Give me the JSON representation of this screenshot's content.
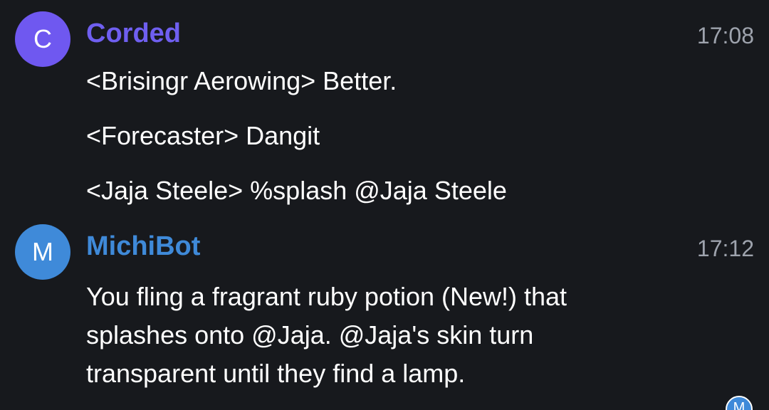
{
  "colors": {
    "background": "#17191d",
    "corded_avatar": "#6f58f0",
    "corded_name": "#6f5ff0",
    "michibot_avatar": "#3f8ad9",
    "michibot_name": "#3f8ad9",
    "timestamp": "#9ea3ad"
  },
  "messages": [
    {
      "avatar_letter": "C",
      "author": "Corded",
      "time": "17:08",
      "lines": [
        "<Brisingr Aerowing> Better.",
        "<Forecaster> Dangit",
        "<Jaja Steele> %splash @Jaja Steele"
      ]
    },
    {
      "avatar_letter": "M",
      "author": "MichiBot",
      "time": "17:12",
      "text": "You fling a fragrant ruby potion (New!) that splashes onto @Jaja. @Jaja's skin turn transparent until they find a lamp."
    }
  ],
  "read_receipt": {
    "avatar_letter": "M"
  }
}
